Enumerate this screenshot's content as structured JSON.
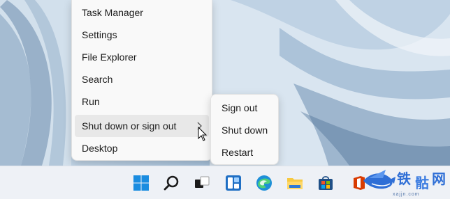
{
  "menu": {
    "items": [
      {
        "label": "Task Manager"
      },
      {
        "label": "Settings"
      },
      {
        "label": "File Explorer"
      },
      {
        "label": "Search"
      },
      {
        "label": "Run"
      },
      {
        "label": "Shut down or sign out"
      },
      {
        "label": "Desktop"
      }
    ]
  },
  "submenu": {
    "items": [
      {
        "label": "Sign out"
      },
      {
        "label": "Shut down"
      },
      {
        "label": "Restart"
      }
    ]
  },
  "taskbar": {
    "icons": [
      "windows-start-icon",
      "search-icon",
      "task-view-icon",
      "widgets-icon",
      "edge-icon",
      "file-explorer-icon",
      "microsoft-store-icon",
      "office-icon"
    ]
  },
  "watermark": {
    "url": "xajjn.com"
  },
  "colors": {
    "menu_bg": "#f9f9f9",
    "hover_bg": "#e8e8e8",
    "taskbar_bg": "#eef1f6",
    "accent": "#0078d4"
  }
}
